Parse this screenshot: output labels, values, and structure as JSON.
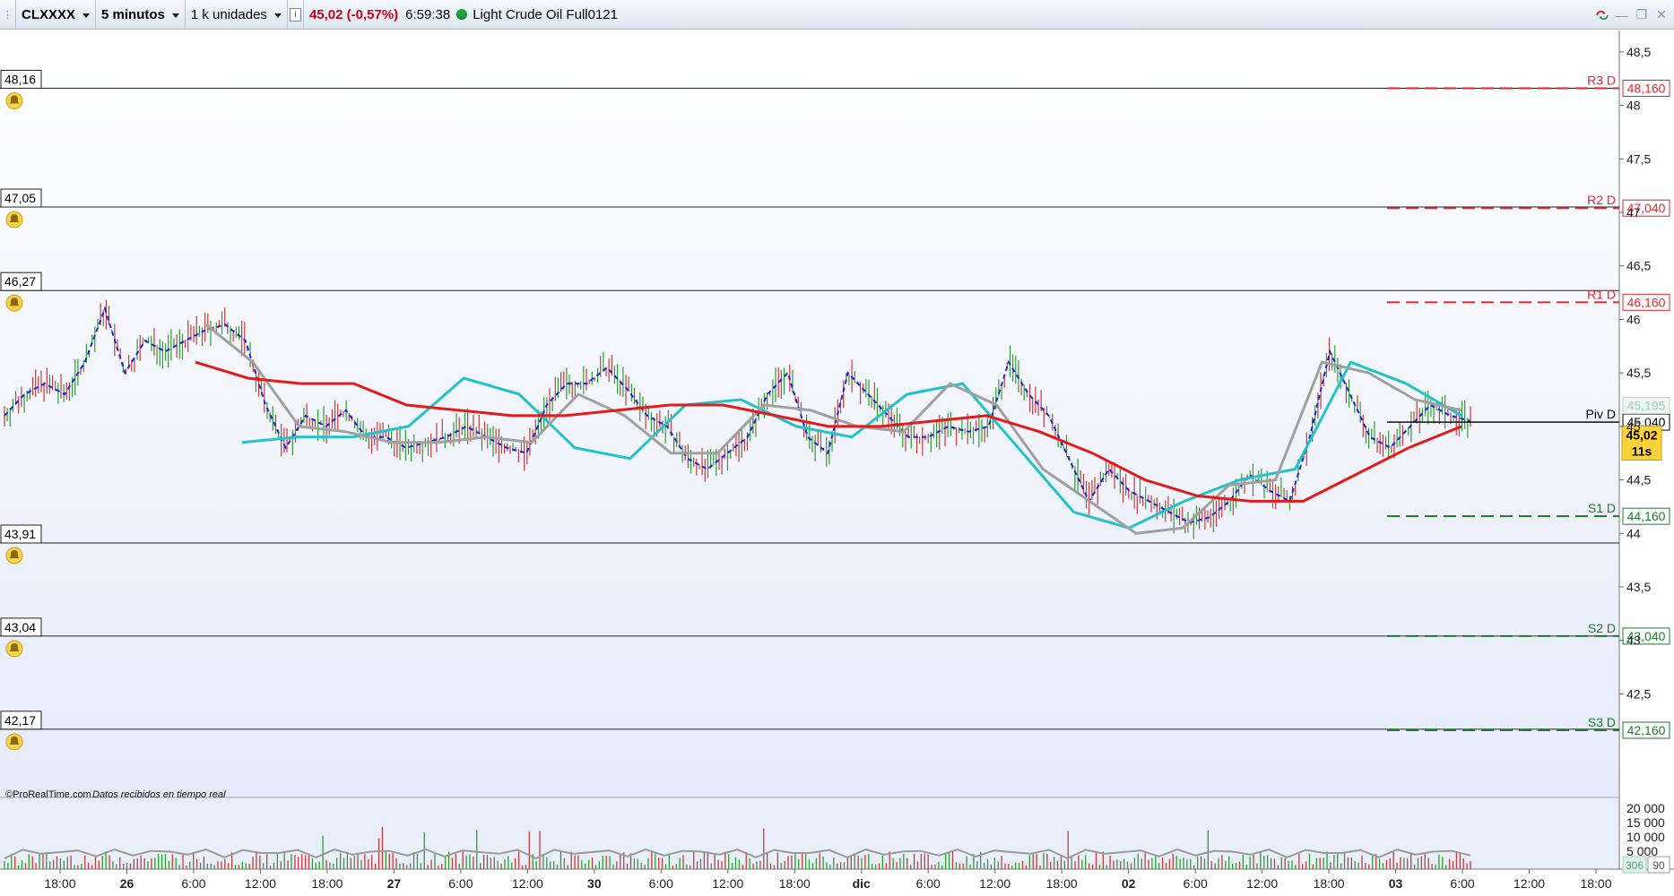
{
  "toolbar": {
    "symbol": "CLXXXX",
    "timeframe": "5 minutos",
    "units": "1 k unidades",
    "info_icon": "info-icon",
    "price_change": "45,02 (-0,57%)",
    "time": "6:59:38",
    "status_color": "#1fa63a",
    "instrument": "Light Crude Oil Full0121"
  },
  "window_controls": [
    "refresh-link-icon",
    "minimize-icon",
    "restore-icon",
    "close-icon"
  ],
  "colors": {
    "background_top": "#ffffff",
    "background_bottom": "#e6ebfb",
    "ma_red": "#e31b1b",
    "ma_gray": "#a0a0a0",
    "ma_cyan": "#20c4c8",
    "ma_dashed": "#1a28d8",
    "resistance": "#e0262e",
    "support": "#1e7a28",
    "price_tag_bg": "#ffd23a"
  },
  "chart_data": {
    "type": "line",
    "title": "Light Crude Oil Full0121",
    "y_range": [
      41.8,
      48.7
    ],
    "y_ticks": [
      "48,5",
      "48",
      "47,5",
      "47",
      "46,5",
      "46",
      "45,5",
      "45",
      "44,5",
      "44",
      "43,5",
      "43",
      "42,5"
    ],
    "x_ticks": [
      "18:00",
      "26",
      "6:00",
      "12:00",
      "18:00",
      "27",
      "6:00",
      "12:00",
      "30",
      "6:00",
      "12:00",
      "18:00",
      "dic",
      "6:00",
      "12:00",
      "18:00",
      "02",
      "6:00",
      "12:00",
      "18:00",
      "03",
      "6:00",
      "12:00",
      "18:00"
    ],
    "x_ticks_bold": [
      "26",
      "27",
      "30",
      "dic",
      "02",
      "03"
    ],
    "alert_lines": [
      {
        "label": "48,16",
        "value": 48.16
      },
      {
        "label": "47,05",
        "value": 47.05
      },
      {
        "label": "46,27",
        "value": 46.27
      },
      {
        "label": "43,91",
        "value": 43.91
      },
      {
        "label": "43,04",
        "value": 43.04
      },
      {
        "label": "42,17",
        "value": 42.17
      }
    ],
    "pivot_levels": [
      {
        "name": "R3 D",
        "value": 48.16,
        "tag": "48,160",
        "kind": "resistance"
      },
      {
        "name": "R2 D",
        "value": 47.04,
        "tag": "47,040",
        "kind": "resistance"
      },
      {
        "name": "R1 D",
        "value": 46.16,
        "tag": "46,160",
        "kind": "resistance"
      },
      {
        "name": "Piv D",
        "value": 45.04,
        "tag": "45,040",
        "kind": "pivot"
      },
      {
        "name": "S1 D",
        "value": 44.16,
        "tag": "44,160",
        "kind": "support"
      },
      {
        "name": "S2 D",
        "value": 43.04,
        "tag": "43,040",
        "kind": "support"
      },
      {
        "name": "S3 D",
        "value": 42.16,
        "tag": "42,160",
        "kind": "support"
      }
    ],
    "hidden_tag": "45,195",
    "last_price": "45,02",
    "countdown": "11s",
    "series": [
      {
        "name": "price",
        "values": [
          45.1,
          45.3,
          45.4,
          45.3,
          45.6,
          46.1,
          45.5,
          45.8,
          45.7,
          45.8,
          45.9,
          45.95,
          45.8,
          45.2,
          44.8,
          45.1,
          45.0,
          45.15,
          44.9,
          44.9,
          44.8,
          44.85,
          44.9,
          45.0,
          44.9,
          44.8,
          44.75,
          45.2,
          45.4,
          45.4,
          45.55,
          45.35,
          45.1,
          45.0,
          44.7,
          44.6,
          44.75,
          44.9,
          45.3,
          45.5,
          44.9,
          44.75,
          45.5,
          45.3,
          45.1,
          44.9,
          44.9,
          45.0,
          44.95,
          45.0,
          45.6,
          45.3,
          45.1,
          44.7,
          44.3,
          44.6,
          44.4,
          44.3,
          44.2,
          44.1,
          44.15,
          44.3,
          44.55,
          44.4,
          44.3,
          44.9,
          45.7,
          45.3,
          44.9,
          44.8,
          45.0,
          45.2,
          45.1,
          45.05
        ]
      },
      {
        "name": "ma_red",
        "values": [
          45.6,
          45.45,
          45.4,
          45.4,
          45.2,
          45.15,
          45.1,
          45.1,
          45.15,
          45.2,
          45.2,
          45.1,
          45.0,
          45.0,
          45.05,
          45.1,
          44.95,
          44.75,
          44.5,
          44.35,
          44.3,
          44.3,
          44.55,
          44.8,
          45.0
        ]
      },
      {
        "name": "ma_gray",
        "values": [
          45.95,
          45.6,
          45.0,
          44.95,
          44.85,
          44.85,
          44.9,
          44.85,
          45.3,
          45.1,
          44.75,
          44.75,
          45.2,
          45.15,
          45.0,
          44.95,
          45.4,
          45.2,
          44.6,
          44.3,
          44.0,
          44.05,
          44.45,
          44.5,
          45.6,
          45.5,
          45.25,
          45.15
        ]
      },
      {
        "name": "ma_cyan",
        "values": [
          44.85,
          44.9,
          44.9,
          45.0,
          45.45,
          45.3,
          44.8,
          44.7,
          45.2,
          45.25,
          45.0,
          44.9,
          45.3,
          45.4,
          44.8,
          44.2,
          44.05,
          44.3,
          44.5,
          44.6,
          45.6,
          45.4,
          45.1
        ]
      }
    ],
    "volume_axis": [
      "20 000",
      "15 000",
      "10 000",
      "5 000"
    ],
    "volume_tags": [
      "306",
      "90"
    ],
    "footer_brand": "©ProRealTime.com",
    "footer_note": "Datos recibidos en tiempo real"
  }
}
